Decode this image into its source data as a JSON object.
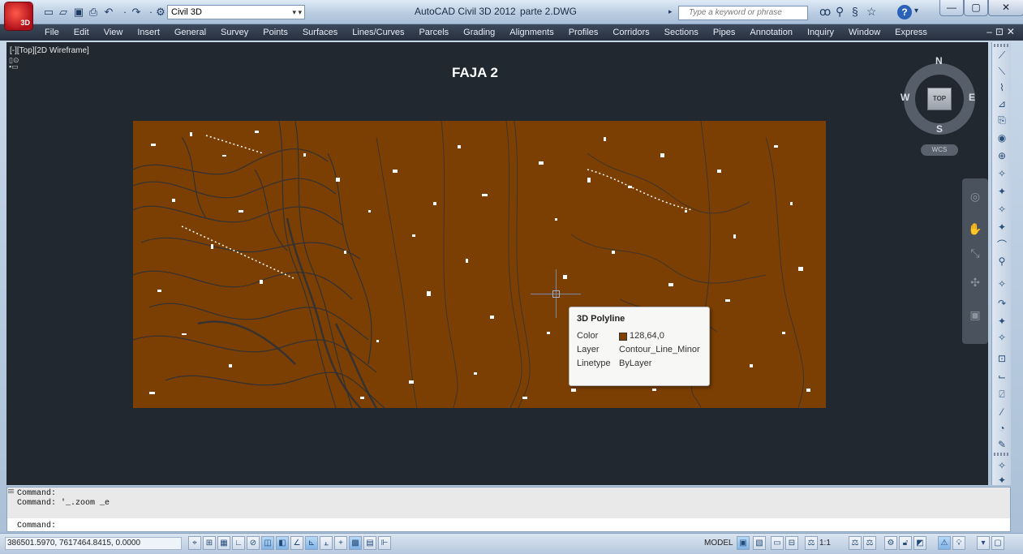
{
  "titlebar": {
    "app_badge": "3D",
    "workspace": "Civil 3D",
    "title": "AutoCAD Civil 3D 2012",
    "file": "parte 2.DWG",
    "search_placeholder": "Type a keyword or phrase",
    "help": "?"
  },
  "menu": {
    "items": [
      "File",
      "Edit",
      "View",
      "Insert",
      "General",
      "Survey",
      "Points",
      "Surfaces",
      "Lines/Curves",
      "Parcels",
      "Grading",
      "Alignments",
      "Profiles",
      "Corridors",
      "Sections",
      "Pipes",
      "Annotation",
      "Inquiry",
      "Window",
      "Express"
    ]
  },
  "viewport": {
    "label": "[-][Top][2D Wireframe]",
    "drawing_title": "FAJA 2",
    "terrain_color": "#7c3f03",
    "line_color": "#2b3038"
  },
  "tooltip": {
    "title": "3D Polyline",
    "rows": [
      {
        "key": "Color",
        "value": "128,64,0"
      },
      {
        "key": "Layer",
        "value": "Contour_Line_Minor"
      },
      {
        "key": "Linetype",
        "value": "ByLayer"
      }
    ],
    "swatch_color": "#804000"
  },
  "viewcube": {
    "north": "N",
    "south": "S",
    "east": "E",
    "west": "W",
    "face": "TOP",
    "wcs": "WCS"
  },
  "command": {
    "history": [
      "Command:",
      "Command: '_.zoom _e"
    ],
    "prompt": "Command:"
  },
  "status": {
    "coordinates": "386501.5970, 7617464.8415, 0.0000",
    "model": "MODEL",
    "scale": "1:1"
  }
}
